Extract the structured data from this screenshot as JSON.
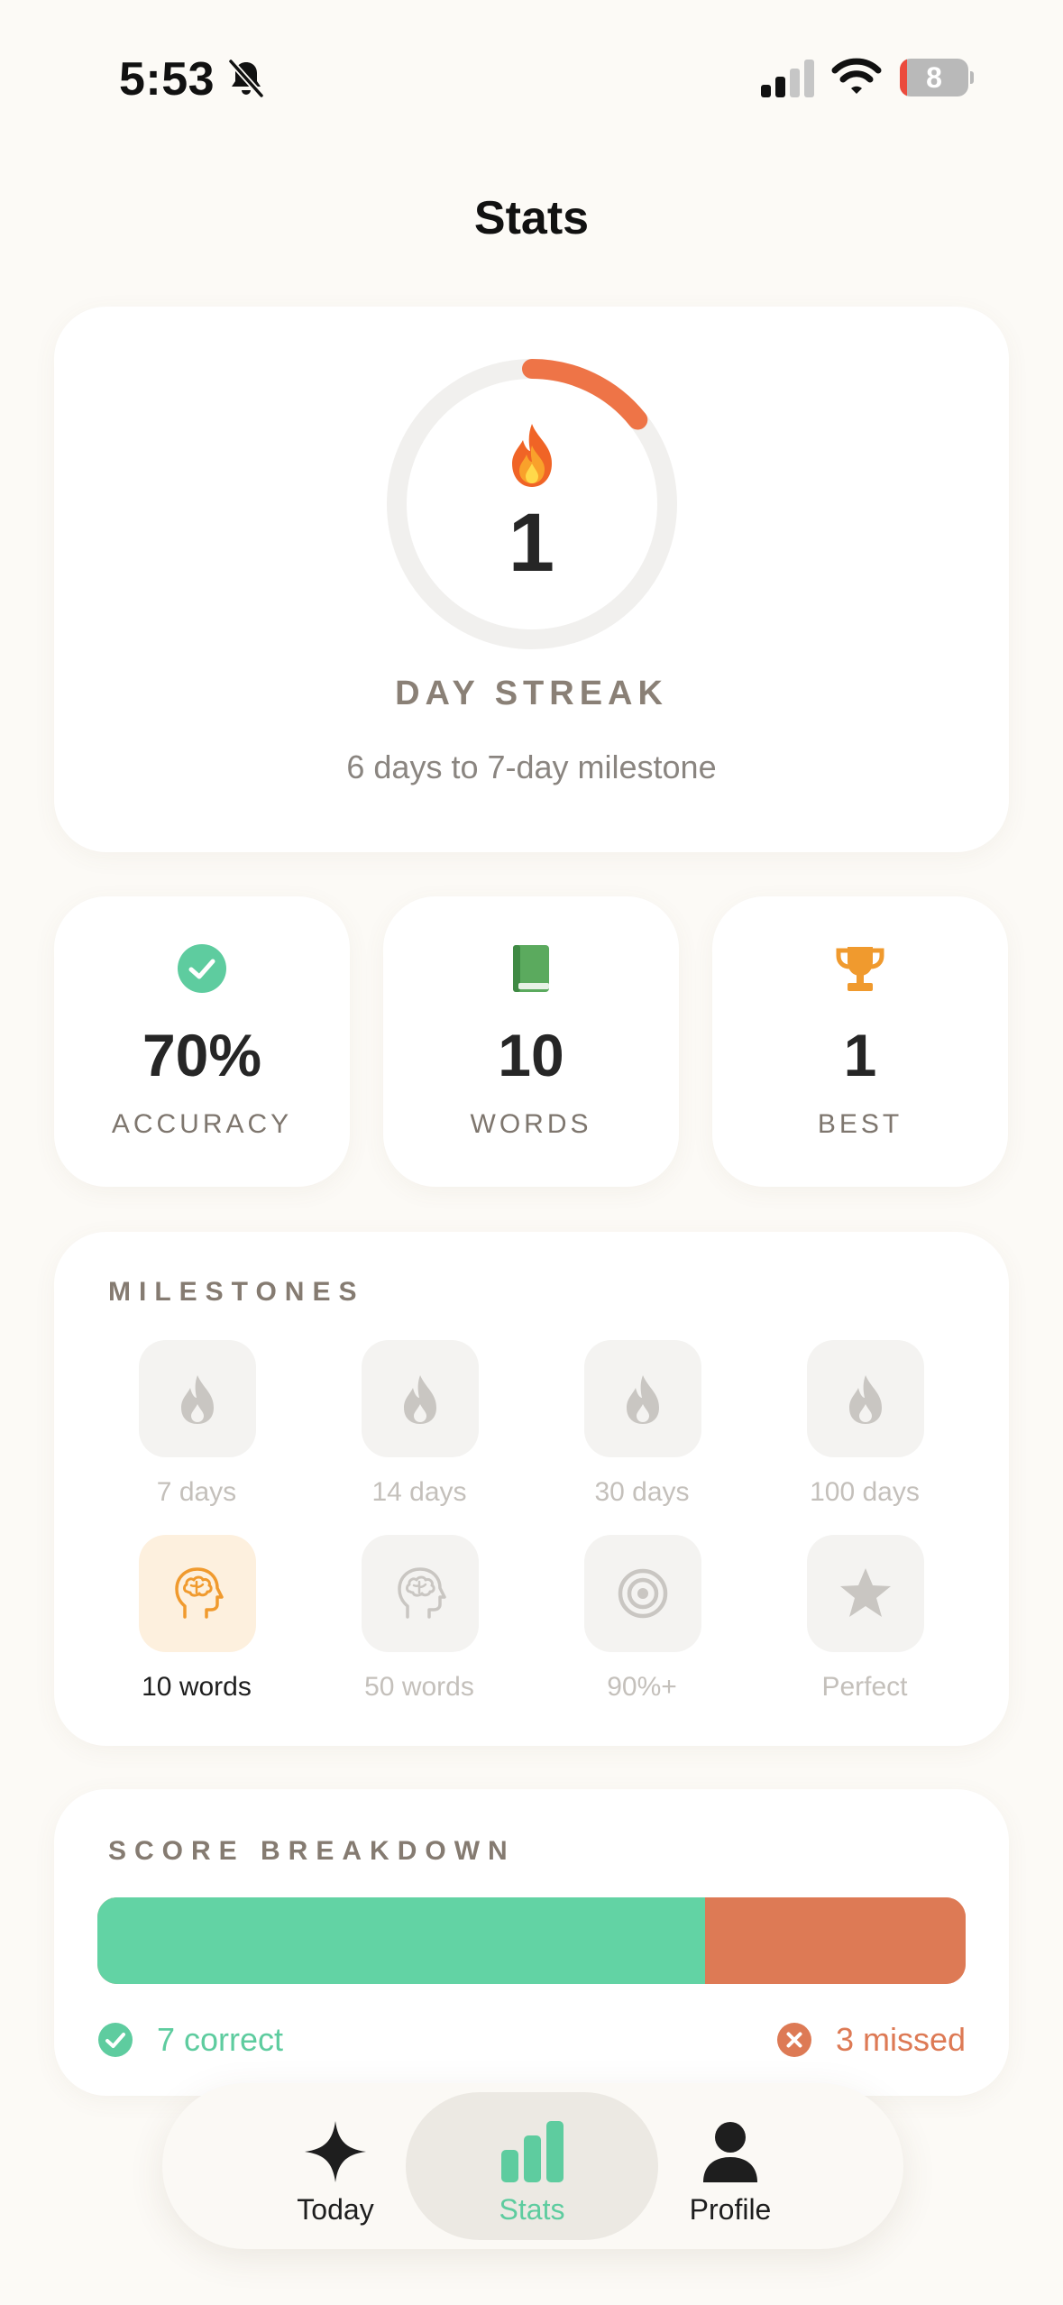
{
  "status_bar": {
    "time": "5:53",
    "battery_level": "8",
    "battery_fraction": 0.08,
    "icons": [
      "bell-slash-icon",
      "cellular-signal-icon",
      "wifi-icon",
      "battery-icon"
    ]
  },
  "title": "Stats",
  "streak": {
    "value": "1",
    "label": "DAY STREAK",
    "subtitle": "6 days to 7-day milestone",
    "progress": 0.1428,
    "icon": "flame-icon",
    "ring_color": "#EE7447"
  },
  "stats": [
    {
      "icon": "check-circle-icon",
      "value": "70%",
      "label": "ACCURACY",
      "color": "#5ECC9F"
    },
    {
      "icon": "book-icon",
      "value": "10",
      "label": "WORDS",
      "color": "#5BAA5E"
    },
    {
      "icon": "trophy-icon",
      "value": "1",
      "label": "BEST",
      "color": "#F09A2E"
    }
  ],
  "milestones": {
    "title": "MILESTONES",
    "items": [
      {
        "label": "7 days",
        "icon": "flame-icon",
        "unlocked": false
      },
      {
        "label": "14 days",
        "icon": "flame-icon",
        "unlocked": false
      },
      {
        "label": "30 days",
        "icon": "flame-icon",
        "unlocked": false
      },
      {
        "label": "100 days",
        "icon": "flame-icon",
        "unlocked": false
      },
      {
        "label": "10 words",
        "icon": "brain-head-icon",
        "unlocked": true
      },
      {
        "label": "50 words",
        "icon": "brain-head-icon",
        "unlocked": false
      },
      {
        "label": "90%+",
        "icon": "target-icon",
        "unlocked": false
      },
      {
        "label": "Perfect",
        "icon": "star-icon",
        "unlocked": false
      }
    ]
  },
  "score_breakdown": {
    "title": "SCORE BREAKDOWN",
    "correct": 7,
    "missed": 3,
    "correct_label": "7 correct",
    "missed_label": "3 missed",
    "correct_color": "#62D3A4",
    "missed_color": "#DD7A55"
  },
  "tab_bar": {
    "tabs": [
      {
        "label": "Today",
        "icon": "sparkle-icon",
        "active": false
      },
      {
        "label": "Stats",
        "icon": "bar-chart-icon",
        "active": true
      },
      {
        "label": "Profile",
        "icon": "person-icon",
        "active": false
      }
    ]
  }
}
